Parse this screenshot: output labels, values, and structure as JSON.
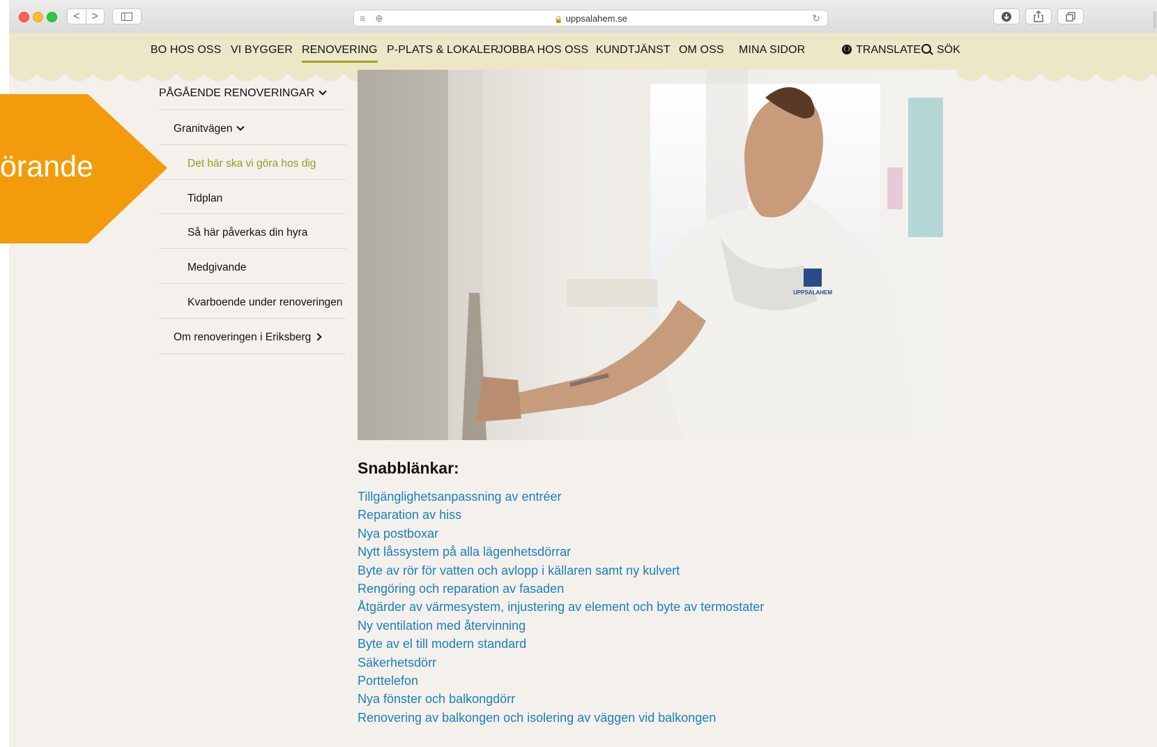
{
  "browser": {
    "url": "uppsalahem.se",
    "lock_icon": "lock-icon",
    "reader_icon": "reader-icon",
    "add_icon": "plus-circle-icon",
    "reload_icon": "reload-icon",
    "back_label": "<",
    "forward_label": ">"
  },
  "nav": {
    "items": [
      {
        "label": "BO HOS OSS"
      },
      {
        "label": "VI BYGGER"
      },
      {
        "label": "RENOVERING",
        "active": true
      },
      {
        "label": "P-PLATS & LOKALER"
      },
      {
        "label": "JOBBA HOS OSS"
      },
      {
        "label": "KUNDTJÄNST"
      },
      {
        "label": "OM OSS"
      },
      {
        "label": "MINA SIDOR"
      }
    ],
    "translate": "TRANSLATE",
    "search": "SÖK"
  },
  "callout": {
    "text": "örande",
    "color": "#f39c0b"
  },
  "submenu": {
    "section": "PÅGÅENDE RENOVERINGAR",
    "group": "Granitvägen",
    "items": [
      {
        "label": "Det här ska vi göra hos dig",
        "active": true
      },
      {
        "label": "Tidplan"
      },
      {
        "label": "Så här påverkas din hyra"
      },
      {
        "label": "Medgivande"
      },
      {
        "label": "Kvarboende under renoveringen"
      }
    ],
    "other": "Om renoveringen i Eriksberg"
  },
  "photo": {
    "shirt_logo": "UPPSALAHEM"
  },
  "quick": {
    "title": "Snabblänkar:",
    "links": [
      "Tillgänglighetsanpassning av entréer",
      "Reparation av hiss",
      "Nya postboxar",
      "Nytt låssystem på alla lägenhetsdörrar",
      "Byte av rör för vatten och avlopp i källaren samt ny kulvert",
      "Rengöring och reparation av fasaden",
      "Åtgärder av värmesystem, injustering av element och byte av termostater",
      "Ny ventilation med återvinning",
      "Byte av el till modern standard",
      "Säkerhetsdörr",
      "Porttelefon",
      "Nya fönster och balkongdörr",
      "Renovering av balkongen och isolering av väggen vid balkongen"
    ]
  },
  "colors": {
    "nav_bg": "#ede7c8",
    "page_bg": "#f4f1ec",
    "accent": "#a3a321",
    "link": "#1a7fbd"
  }
}
